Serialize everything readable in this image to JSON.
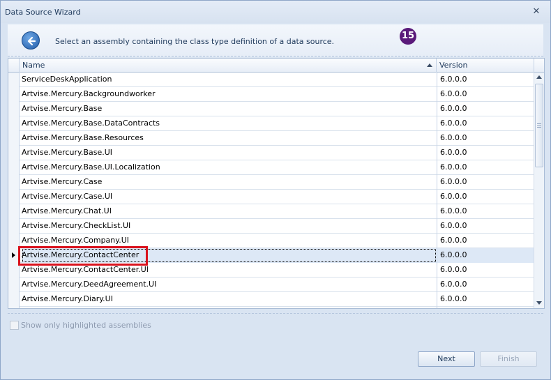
{
  "window": {
    "title": "Data Source Wizard"
  },
  "header": {
    "instruction": "Select an assembly containing the class type definition of a data source.",
    "step_badge": "15"
  },
  "grid": {
    "columns": [
      "Name",
      "Version"
    ],
    "rows": [
      {
        "name": "ServiceDeskApplication",
        "version": "6.0.0.0"
      },
      {
        "name": "Artvise.Mercury.Backgroundworker",
        "version": "6.0.0.0"
      },
      {
        "name": "Artvise.Mercury.Base",
        "version": "6.0.0.0"
      },
      {
        "name": "Artvise.Mercury.Base.DataContracts",
        "version": "6.0.0.0"
      },
      {
        "name": "Artvise.Mercury.Base.Resources",
        "version": "6.0.0.0"
      },
      {
        "name": "Artvise.Mercury.Base.UI",
        "version": "6.0.0.0"
      },
      {
        "name": "Artvise.Mercury.Base.UI.Localization",
        "version": "6.0.0.0"
      },
      {
        "name": "Artvise.Mercury.Case",
        "version": "6.0.0.0"
      },
      {
        "name": "Artvise.Mercury.Case.UI",
        "version": "6.0.0.0"
      },
      {
        "name": "Artvise.Mercury.Chat.UI",
        "version": "6.0.0.0"
      },
      {
        "name": "Artvise.Mercury.CheckList.UI",
        "version": "6.0.0.0"
      },
      {
        "name": "Artvise.Mercury.Company.UI",
        "version": "6.0.0.0"
      },
      {
        "name": "Artvise.Mercury.ContactCenter",
        "version": "6.0.0.0"
      },
      {
        "name": "Artvise.Mercury.ContactCenter.UI",
        "version": "6.0.0.0"
      },
      {
        "name": "Artvise.Mercury.DeedAgreement.UI",
        "version": "6.0.0.0"
      },
      {
        "name": "Artvise.Mercury.Diary.UI",
        "version": "6.0.0.0"
      },
      {
        "name": "",
        "version": ""
      }
    ],
    "selected_index": 12
  },
  "options": {
    "show_highlighted_label": "Show only highlighted assemblies"
  },
  "buttons": {
    "next": "Next",
    "finish": "Finish"
  },
  "colors": {
    "highlight_box": "#d9121d",
    "step_badge": "#5a1a7a"
  },
  "icons": {
    "back": "back-arrow-icon",
    "close": "close-icon"
  }
}
